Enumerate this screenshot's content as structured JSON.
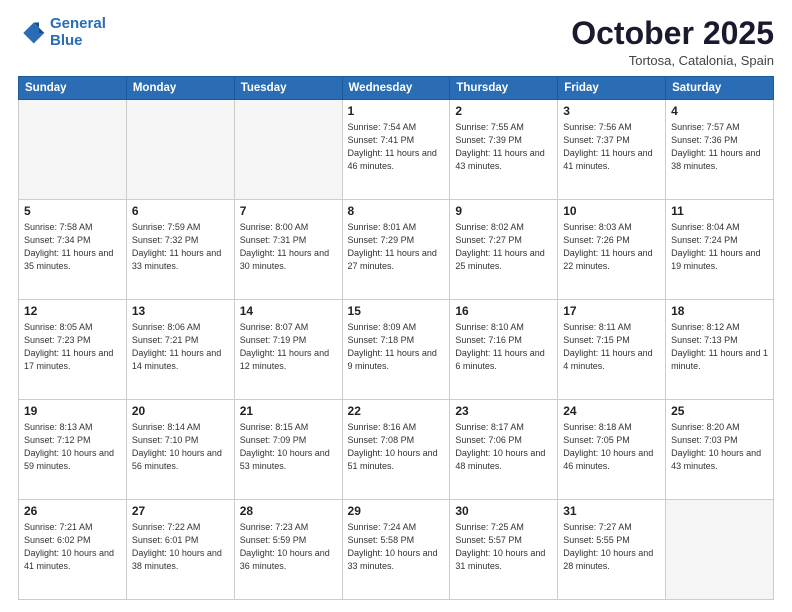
{
  "header": {
    "logo_line1": "General",
    "logo_line2": "Blue",
    "month": "October 2025",
    "location": "Tortosa, Catalonia, Spain"
  },
  "weekdays": [
    "Sunday",
    "Monday",
    "Tuesday",
    "Wednesday",
    "Thursday",
    "Friday",
    "Saturday"
  ],
  "weeks": [
    [
      {
        "day": "",
        "info": ""
      },
      {
        "day": "",
        "info": ""
      },
      {
        "day": "",
        "info": ""
      },
      {
        "day": "1",
        "info": "Sunrise: 7:54 AM\nSunset: 7:41 PM\nDaylight: 11 hours\nand 46 minutes."
      },
      {
        "day": "2",
        "info": "Sunrise: 7:55 AM\nSunset: 7:39 PM\nDaylight: 11 hours\nand 43 minutes."
      },
      {
        "day": "3",
        "info": "Sunrise: 7:56 AM\nSunset: 7:37 PM\nDaylight: 11 hours\nand 41 minutes."
      },
      {
        "day": "4",
        "info": "Sunrise: 7:57 AM\nSunset: 7:36 PM\nDaylight: 11 hours\nand 38 minutes."
      }
    ],
    [
      {
        "day": "5",
        "info": "Sunrise: 7:58 AM\nSunset: 7:34 PM\nDaylight: 11 hours\nand 35 minutes."
      },
      {
        "day": "6",
        "info": "Sunrise: 7:59 AM\nSunset: 7:32 PM\nDaylight: 11 hours\nand 33 minutes."
      },
      {
        "day": "7",
        "info": "Sunrise: 8:00 AM\nSunset: 7:31 PM\nDaylight: 11 hours\nand 30 minutes."
      },
      {
        "day": "8",
        "info": "Sunrise: 8:01 AM\nSunset: 7:29 PM\nDaylight: 11 hours\nand 27 minutes."
      },
      {
        "day": "9",
        "info": "Sunrise: 8:02 AM\nSunset: 7:27 PM\nDaylight: 11 hours\nand 25 minutes."
      },
      {
        "day": "10",
        "info": "Sunrise: 8:03 AM\nSunset: 7:26 PM\nDaylight: 11 hours\nand 22 minutes."
      },
      {
        "day": "11",
        "info": "Sunrise: 8:04 AM\nSunset: 7:24 PM\nDaylight: 11 hours\nand 19 minutes."
      }
    ],
    [
      {
        "day": "12",
        "info": "Sunrise: 8:05 AM\nSunset: 7:23 PM\nDaylight: 11 hours\nand 17 minutes."
      },
      {
        "day": "13",
        "info": "Sunrise: 8:06 AM\nSunset: 7:21 PM\nDaylight: 11 hours\nand 14 minutes."
      },
      {
        "day": "14",
        "info": "Sunrise: 8:07 AM\nSunset: 7:19 PM\nDaylight: 11 hours\nand 12 minutes."
      },
      {
        "day": "15",
        "info": "Sunrise: 8:09 AM\nSunset: 7:18 PM\nDaylight: 11 hours\nand 9 minutes."
      },
      {
        "day": "16",
        "info": "Sunrise: 8:10 AM\nSunset: 7:16 PM\nDaylight: 11 hours\nand 6 minutes."
      },
      {
        "day": "17",
        "info": "Sunrise: 8:11 AM\nSunset: 7:15 PM\nDaylight: 11 hours\nand 4 minutes."
      },
      {
        "day": "18",
        "info": "Sunrise: 8:12 AM\nSunset: 7:13 PM\nDaylight: 11 hours\nand 1 minute."
      }
    ],
    [
      {
        "day": "19",
        "info": "Sunrise: 8:13 AM\nSunset: 7:12 PM\nDaylight: 10 hours\nand 59 minutes."
      },
      {
        "day": "20",
        "info": "Sunrise: 8:14 AM\nSunset: 7:10 PM\nDaylight: 10 hours\nand 56 minutes."
      },
      {
        "day": "21",
        "info": "Sunrise: 8:15 AM\nSunset: 7:09 PM\nDaylight: 10 hours\nand 53 minutes."
      },
      {
        "day": "22",
        "info": "Sunrise: 8:16 AM\nSunset: 7:08 PM\nDaylight: 10 hours\nand 51 minutes."
      },
      {
        "day": "23",
        "info": "Sunrise: 8:17 AM\nSunset: 7:06 PM\nDaylight: 10 hours\nand 48 minutes."
      },
      {
        "day": "24",
        "info": "Sunrise: 8:18 AM\nSunset: 7:05 PM\nDaylight: 10 hours\nand 46 minutes."
      },
      {
        "day": "25",
        "info": "Sunrise: 8:20 AM\nSunset: 7:03 PM\nDaylight: 10 hours\nand 43 minutes."
      }
    ],
    [
      {
        "day": "26",
        "info": "Sunrise: 7:21 AM\nSunset: 6:02 PM\nDaylight: 10 hours\nand 41 minutes."
      },
      {
        "day": "27",
        "info": "Sunrise: 7:22 AM\nSunset: 6:01 PM\nDaylight: 10 hours\nand 38 minutes."
      },
      {
        "day": "28",
        "info": "Sunrise: 7:23 AM\nSunset: 5:59 PM\nDaylight: 10 hours\nand 36 minutes."
      },
      {
        "day": "29",
        "info": "Sunrise: 7:24 AM\nSunset: 5:58 PM\nDaylight: 10 hours\nand 33 minutes."
      },
      {
        "day": "30",
        "info": "Sunrise: 7:25 AM\nSunset: 5:57 PM\nDaylight: 10 hours\nand 31 minutes."
      },
      {
        "day": "31",
        "info": "Sunrise: 7:27 AM\nSunset: 5:55 PM\nDaylight: 10 hours\nand 28 minutes."
      },
      {
        "day": "",
        "info": ""
      }
    ]
  ]
}
